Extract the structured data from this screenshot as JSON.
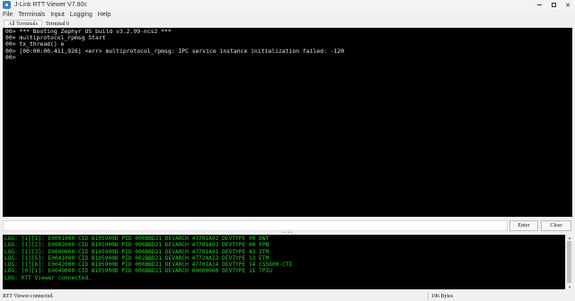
{
  "window": {
    "title": "J-Link RTT Viewer V7.80c",
    "minimize_label": "–",
    "maximize_label": "",
    "close_label": "✕"
  },
  "menu": {
    "items": [
      "File",
      "Terminals",
      "Input",
      "Logging",
      "Help"
    ]
  },
  "tabs": [
    {
      "label": "All Terminals",
      "active": true
    },
    {
      "label": "Terminal 0",
      "active": false
    }
  ],
  "terminal": {
    "lines": [
      "00> *** Booting Zephyr OS build v3.2.99-ncs2 ***",
      "00> multiprotocol_rpmsg Start",
      "00> tx_thread() e",
      "00> [00:00:00.411,926] <err> multiprotocol_rpmsg: IPC service instance initialization failed: -120",
      "00>"
    ]
  },
  "input": {
    "value": "",
    "enter_label": "Enter",
    "clear_label": "Clear"
  },
  "log": {
    "lines": [
      "LOG: [1][1]: E0001000 CID B105900D PID 000BBD21 DEVARCH 47701A02 DEVTYPE 00 DWT",
      "LOG: [1][2]: E0002000 CID B105900D PID 000BBD21 DEVARCH 47701A03 DEVTYPE 00 FPB",
      "LOG: [1][3]: E0000000 CID B105900D PID 000BBD21 DEVARCH 47701A01 DEVTYPE 43 ITM",
      "LOG: [1][5]: E0041000 CID B105900D PID 002BBD21 DEVARCH 47724A13 DEVTYPE 13 ETM",
      "LOG: [1][6]: E0042000 CID B105900D PID 000BBD21 DEVARCH 47701A14 DEVTYPE 14 CSS600-CTI",
      "LOG: [0][1]: E0040000 CID B105900D PID 000BBD21 DEVARCH 00000000 DEVTYPE 11 TPIU",
      "LOG: RTT Viewer connected."
    ]
  },
  "status": {
    "connection": "RTT Viewer connected.",
    "bytes": "196 Bytes"
  }
}
